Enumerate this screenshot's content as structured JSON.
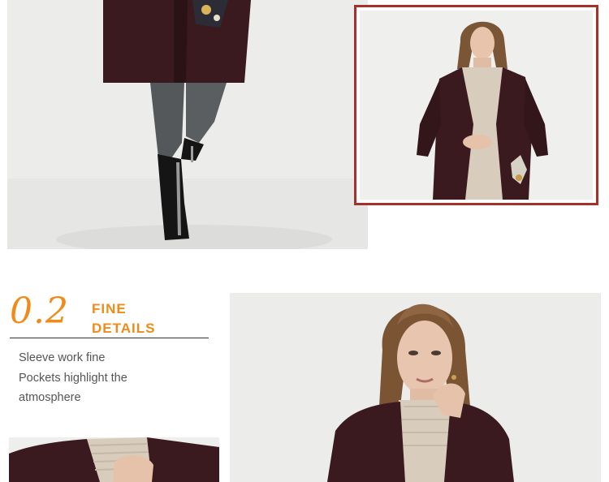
{
  "feature": {
    "number": "0.2",
    "heading_line1": "FINE",
    "heading_line2": "DETAILS",
    "description": [
      "Sleeve work fine",
      "Pockets highlight the",
      "atmosphere"
    ]
  },
  "colors": {
    "accent": "#f08a18",
    "frame": "#a6312a",
    "coat": "#3a1a1f",
    "sweater": "#d8ccbc",
    "backdrop": "#ececeb"
  }
}
